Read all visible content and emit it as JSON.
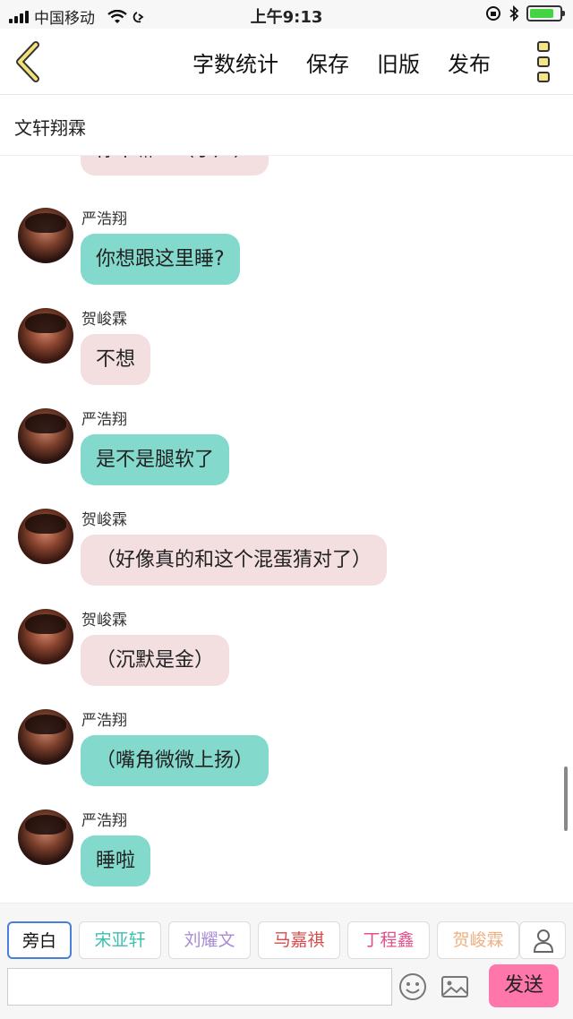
{
  "status_bar": {
    "carrier": "中国移动",
    "time": "上午9:13"
  },
  "nav": {
    "actions": [
      "字数统计",
      "保存",
      "旧版",
      "发布"
    ]
  },
  "title": "文轩翔霖",
  "messages": [
    {
      "speaker": "",
      "text": "你干嘛！（小声）",
      "color": "#f3dfe0"
    },
    {
      "speaker": "严浩翔",
      "text": "你想跟这里睡?",
      "color": "#84d9cd"
    },
    {
      "speaker": "贺峻霖",
      "text": "不想",
      "color": "#f3dfe0"
    },
    {
      "speaker": "严浩翔",
      "text": "是不是腿软了",
      "color": "#84d9cd"
    },
    {
      "speaker": "贺峻霖",
      "text": "（好像真的和这个混蛋猜对了）",
      "color": "#f3dfe0"
    },
    {
      "speaker": "贺峻霖",
      "text": "（沉默是金）",
      "color": "#f3dfe0"
    },
    {
      "speaker": "严浩翔",
      "text": "（嘴角微微上扬）",
      "color": "#84d9cd"
    },
    {
      "speaker": "严浩翔",
      "text": "睡啦",
      "color": "#84d9cd"
    }
  ],
  "roles": [
    {
      "label": "旁白",
      "color": "#222222"
    },
    {
      "label": "宋亚轩",
      "color": "#3fbfb0"
    },
    {
      "label": "刘耀文",
      "color": "#a98bd6"
    },
    {
      "label": "马嘉祺",
      "color": "#d94a4a"
    },
    {
      "label": "丁程鑫",
      "color": "#e0508a"
    },
    {
      "label": "贺峻霖",
      "color": "#f0b080"
    }
  ],
  "composer": {
    "placeholder": "",
    "send_label": "发送"
  },
  "icons": [
    "back-chevron-icon",
    "more-menu-icon",
    "emoji-icon",
    "image-icon",
    "user-icon"
  ]
}
